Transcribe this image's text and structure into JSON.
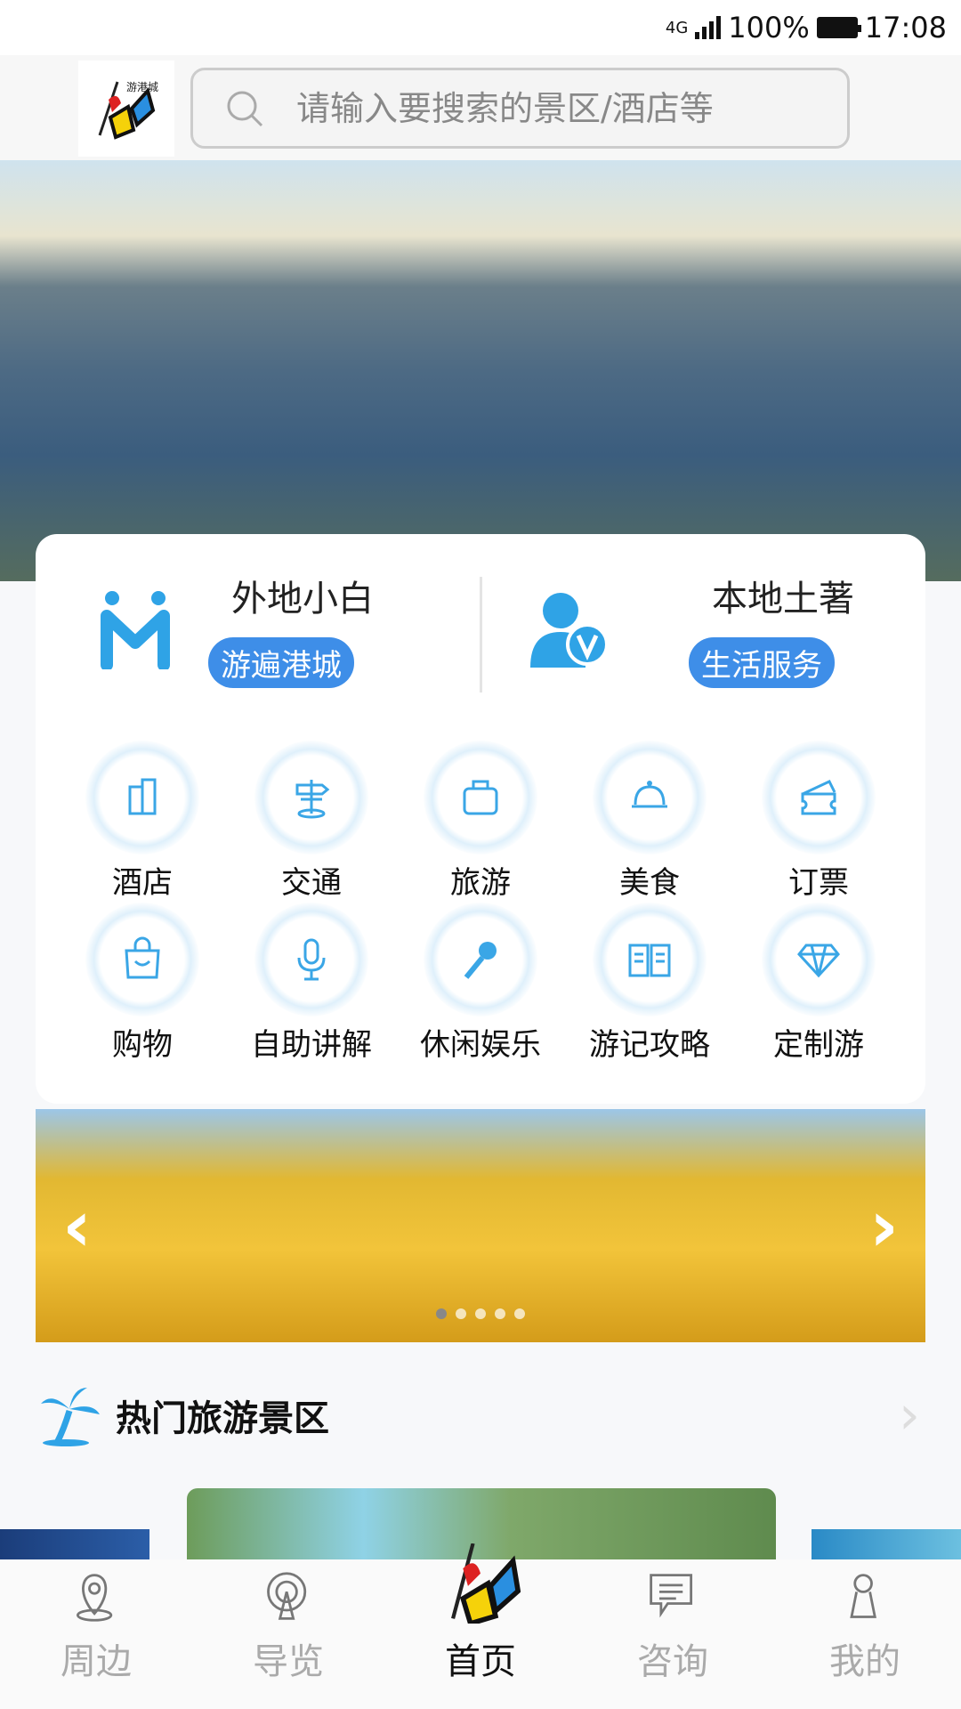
{
  "status_bar": {
    "network": "4G",
    "battery": "100%",
    "time": "17:08"
  },
  "header": {
    "search_placeholder": "请输入要搜索的景区/酒店等",
    "logo_text": "游港城"
  },
  "feature": {
    "left": {
      "title": "外地小白",
      "tag": "游遍港城"
    },
    "right": {
      "title": "本地土著",
      "tag": "生活服务"
    }
  },
  "grid": [
    {
      "label": "酒店",
      "icon": "hotel-icon"
    },
    {
      "label": "交通",
      "icon": "signpost-icon"
    },
    {
      "label": "旅游",
      "icon": "luggage-icon"
    },
    {
      "label": "美食",
      "icon": "food-cloche-icon"
    },
    {
      "label": "订票",
      "icon": "ticket-icon"
    },
    {
      "label": "购物",
      "icon": "shopping-bag-icon"
    },
    {
      "label": "自助讲解",
      "icon": "microphone-icon"
    },
    {
      "label": "休闲娱乐",
      "icon": "karaoke-mic-icon"
    },
    {
      "label": "游记攻略",
      "icon": "book-icon"
    },
    {
      "label": "定制游",
      "icon": "diamond-icon"
    }
  ],
  "carousel": {
    "slides": 5,
    "active": 0
  },
  "hot_section": {
    "title": "热门旅游景区"
  },
  "nav": [
    {
      "label": "周边",
      "icon": "location-pin-icon"
    },
    {
      "label": "导览",
      "icon": "broadcast-icon"
    },
    {
      "label": "首页",
      "icon": "home-logo-icon",
      "active": true
    },
    {
      "label": "咨询",
      "icon": "chat-icon"
    },
    {
      "label": "我的",
      "icon": "user-icon"
    }
  ],
  "colors": {
    "accent": "#3e8ee8",
    "icon_blue": "#2fa3e6"
  }
}
